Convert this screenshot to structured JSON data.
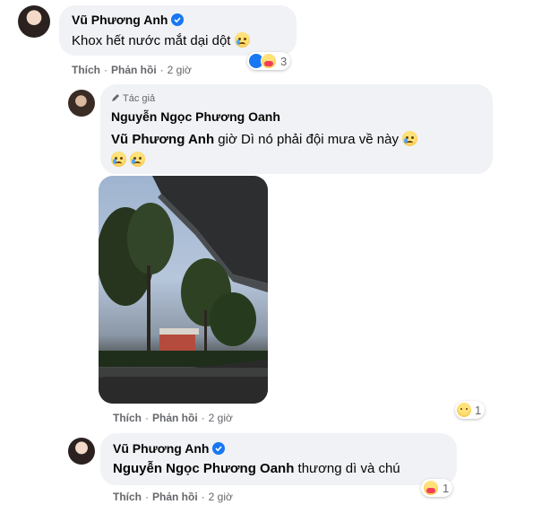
{
  "comments": [
    {
      "name": "Vũ Phương Anh",
      "verified": true,
      "text": "Khox hết nước mắt dại dột",
      "actions": {
        "like": "Thích",
        "reply": "Phản hồi",
        "time": "2 giờ"
      },
      "reactions": {
        "icons": [
          "like-icon",
          "care-icon"
        ],
        "count": "3"
      }
    },
    {
      "author_tag": "Tác giả",
      "name": "Nguyễn Ngọc Phương Oanh",
      "mention": "Vũ Phương Anh",
      "text": " giờ Dì nó phải đội mưa về này",
      "actions": {
        "like": "Thích",
        "reply": "Phản hồi",
        "time": "2 giờ"
      },
      "reactions": {
        "icons": [
          "sad-icon"
        ],
        "count": "1"
      }
    },
    {
      "name": "Vũ Phương Anh",
      "verified": true,
      "mention": "Nguyễn Ngọc Phương Oanh",
      "text": " thương dì và chú",
      "actions": {
        "like": "Thích",
        "reply": "Phản hồi",
        "time": "2 giờ"
      },
      "reactions": {
        "icons": [
          "care-icon"
        ],
        "count": "1"
      }
    }
  ],
  "colors": {
    "bubble": "#f0f2f5",
    "text": "#050505",
    "meta": "#65676b",
    "verified": "#1877f2"
  }
}
